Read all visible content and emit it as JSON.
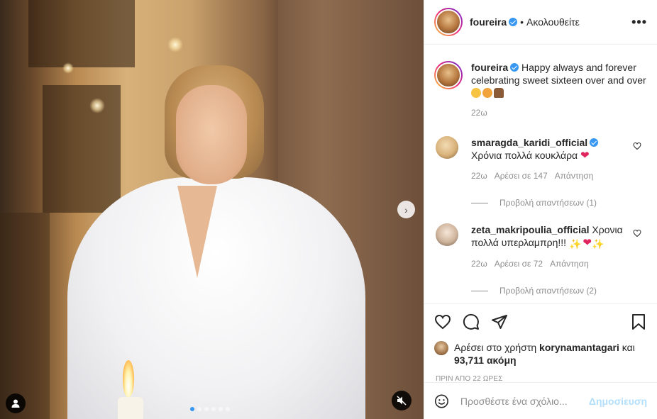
{
  "post": {
    "username": "foureira",
    "follow_separator": "•",
    "follow_status": "Ακολουθείτε",
    "more_label": "•••"
  },
  "caption": {
    "username": "foureira",
    "text": "Happy always and forever celebrating sweet sixteen over and over",
    "time": "22ω"
  },
  "comments": [
    {
      "username": "smaragda_karidi_official",
      "text": "Χρόνια πολλά κουκλάρα",
      "emoji": "❤",
      "time": "22ω",
      "likes": "Αρέσει σε 147",
      "reply_label": "Απάντηση",
      "view_replies": "Προβολή απαντήσεων (1)"
    },
    {
      "username": "zeta_makripoulia_official",
      "text": "Χρονια πολλά υπερλαμπρη!!!",
      "time": "22ω",
      "likes": "Αρέσει σε 72",
      "reply_label": "Απάντηση",
      "view_replies": "Προβολή απαντήσεων (2)"
    }
  ],
  "likes_summary": {
    "prefix": "Αρέσει στο χρήστη",
    "user": "korynamantagari",
    "connector": "και",
    "others": "93,711 ακόμη"
  },
  "posted_time": "ΠΡΙΝ ΑΠΟ 22 ΩΡΕΣ",
  "add_comment": {
    "placeholder": "Προσθέστε ένα σχόλιο...",
    "post_label": "Δημοσίευση"
  },
  "media": {
    "slide_count": 6,
    "active_slide": 1,
    "next_label": "›"
  },
  "colors": {
    "accent": "#3897f0",
    "heart_red": "#e0245e",
    "post_disabled": "#b2dffc",
    "muted_text": "#8e8e8e"
  }
}
